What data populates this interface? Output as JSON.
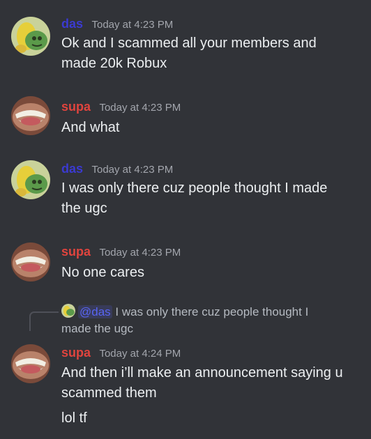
{
  "messages": [
    {
      "username": "das",
      "timestamp": "Today at 4:23 PM",
      "lines": [
        "Ok and I scammed all your members and",
        "made 20k Robux"
      ]
    },
    {
      "username": "supa",
      "timestamp": "Today at 4:23 PM",
      "lines": [
        "And what"
      ]
    },
    {
      "username": "das",
      "timestamp": "Today at 4:23 PM",
      "lines": [
        "I was only there cuz people thought I made",
        "the ugc"
      ]
    },
    {
      "username": "supa",
      "timestamp": "Today at 4:23 PM",
      "lines": [
        "No one cares"
      ]
    },
    {
      "reply": {
        "mention": "@das",
        "text_line1": "I was only there cuz people thought I",
        "text_line2": "made the ugc"
      },
      "username": "supa",
      "timestamp": "Today at 4:24 PM",
      "lines": [
        "And then i’ll make an announcement saying u",
        "scammed them"
      ],
      "followup": "lol tf"
    }
  ],
  "colors": {
    "background": "#313338",
    "das_name": "#3b3ad0",
    "supa_name": "#e0443e",
    "text": "#eceff1",
    "timestamp": "#a3a6ad"
  }
}
